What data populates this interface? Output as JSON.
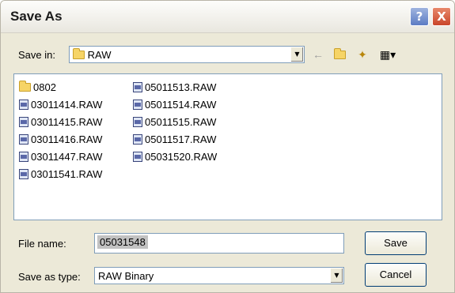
{
  "window": {
    "title": "Save As",
    "help_label": "?",
    "close_label": "X"
  },
  "save_in": {
    "label": "Save in:",
    "value": "RAW"
  },
  "toolbar": {
    "back_glyph": "←",
    "up_glyph": "⇧",
    "new_folder_glyph": "✦",
    "views_glyph": "▦▾"
  },
  "files": {
    "column1": [
      {
        "name": "0802",
        "type": "folder"
      },
      {
        "name": "03011414.RAW",
        "type": "file"
      },
      {
        "name": "03011415.RAW",
        "type": "file"
      },
      {
        "name": "03011416.RAW",
        "type": "file"
      },
      {
        "name": "03011447.RAW",
        "type": "file"
      },
      {
        "name": "03011541.RAW",
        "type": "file"
      }
    ],
    "column2": [
      {
        "name": "05011513.RAW",
        "type": "file"
      },
      {
        "name": "05011514.RAW",
        "type": "file"
      },
      {
        "name": "05011515.RAW",
        "type": "file"
      },
      {
        "name": "05011517.RAW",
        "type": "file"
      },
      {
        "name": "05031520.RAW",
        "type": "file"
      }
    ]
  },
  "file_name": {
    "label": "File name:",
    "value": "05031548"
  },
  "save_as_type": {
    "label": "Save as type:",
    "value": "RAW Binary"
  },
  "buttons": {
    "save": "Save",
    "cancel": "Cancel"
  },
  "colors": {
    "dialog_bg": "#ece9d8",
    "field_border": "#7f9db9",
    "button_border": "#003c74",
    "close_red": "#c9452a"
  }
}
